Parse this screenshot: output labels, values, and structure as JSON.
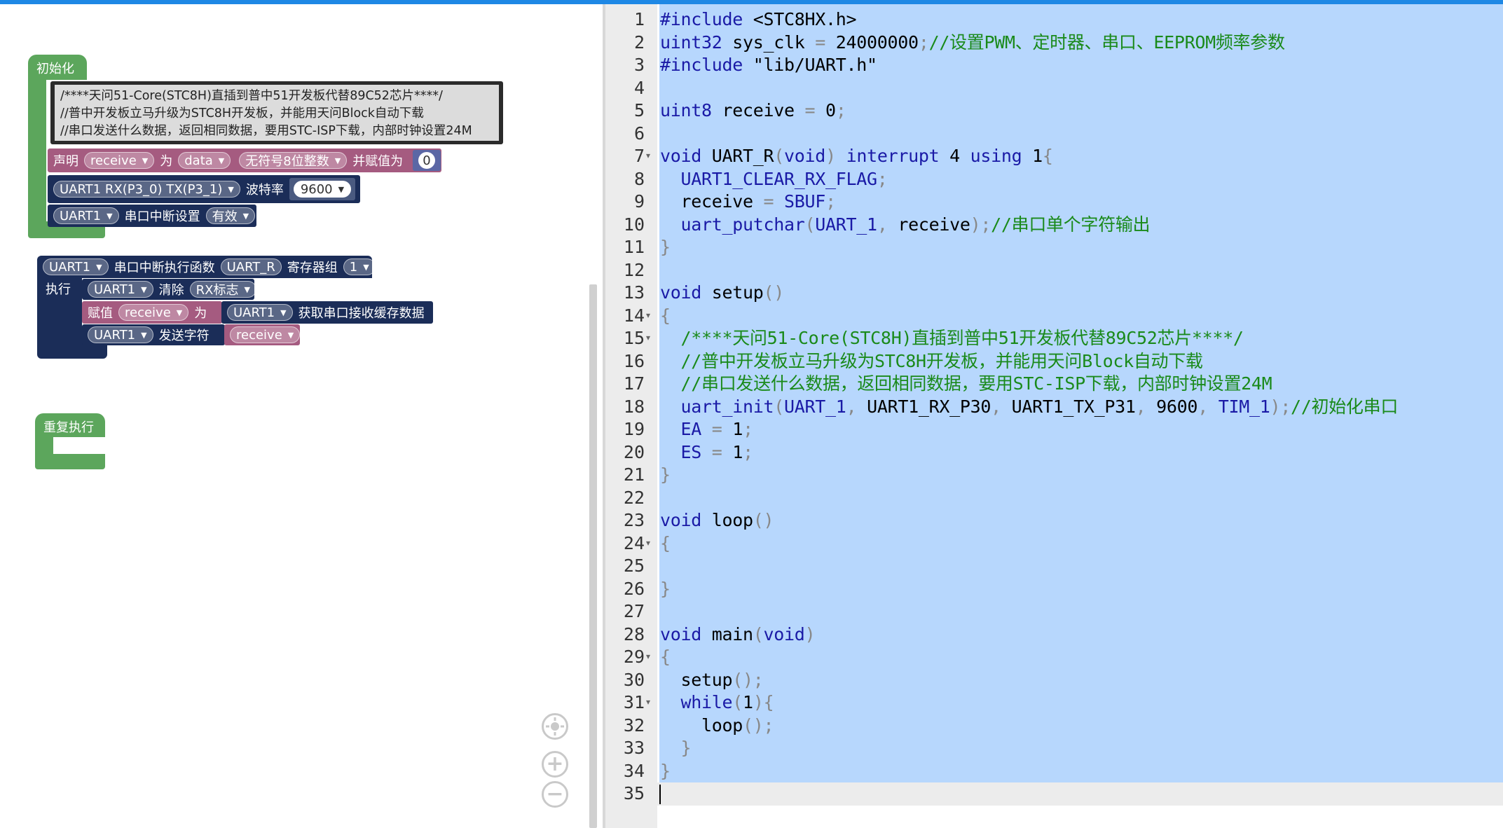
{
  "blocks": {
    "setup_label": "初始化",
    "comment_lines": [
      "/****天问51-Core(STC8H)直插到普中51开发板代替89C52芯片****/",
      "//普中开发板立马升级为STC8H开发板，并能用天问Block自动下载",
      "//串口发送什么数据，返回相同数据，要用STC-ISP下载，内部时钟设置24M"
    ],
    "declare": {
      "label": "声明",
      "var": "receive",
      "as": "为",
      "type": "data",
      "dtype": "无符号8位整数",
      "init_label": "并赋值为",
      "init_value": "0"
    },
    "uart_init": {
      "pins": "UART1 RX(P3_0) TX(P3_1)",
      "baud_label": "波特率",
      "baud": "9600"
    },
    "uart_irq_set": {
      "port": "UART1",
      "label": "串口中断设置",
      "state": "有效"
    },
    "isr": {
      "port": "UART1",
      "label": "串口中断执行函数",
      "name": "UART_R",
      "reg_label": "寄存器组",
      "reg": "1",
      "exec_label": "执行",
      "clear": {
        "port": "UART1",
        "label": "清除",
        "flag": "RX标志"
      },
      "assign": {
        "label": "赋值",
        "var": "receive",
        "as": "为",
        "port": "UART1",
        "get_label": "获取串口接收缓存数据"
      },
      "send": {
        "port": "UART1",
        "label": "发送字符",
        "var": "receive"
      }
    },
    "loop_label": "重复执行"
  },
  "colors": {
    "green": "#5ca65c",
    "navy": "#1b2d58",
    "pink": "#a55b80",
    "number": "#5b67a5"
  },
  "icons": {
    "recenter": "target-icon",
    "zoom_in": "plus-icon",
    "zoom_out": "minus-icon"
  },
  "code_lines": [
    "#include <STC8HX.h>",
    "uint32 sys_clk = 24000000;//设置PWM、定时器、串口、EEPROM频率参数",
    "#include \"lib/UART.h\"",
    "",
    "uint8 receive = 0;",
    "",
    "void UART_R(void) interrupt 4 using 1{",
    "  UART1_CLEAR_RX_FLAG;",
    "  receive = SBUF;",
    "  uart_putchar(UART_1, receive);//串口单个字符输出",
    "}",
    "",
    "void setup()",
    "{",
    "  /****天问51-Core(STC8H)直插到普中51开发板代替89C52芯片****/",
    "  //普中开发板立马升级为STC8H开发板，并能用天问Block自动下载",
    "  //串口发送什么数据，返回相同数据，要用STC-ISP下载，内部时钟设置24M",
    "  uart_init(UART_1, UART1_RX_P30, UART1_TX_P31, 9600, TIM_1);//初始化串口",
    "  EA = 1;",
    "  ES = 1;",
    "}",
    "",
    "void loop()",
    "{",
    "",
    "}",
    "",
    "void main(void)",
    "{",
    "  setup();",
    "  while(1){",
    "    loop();",
    "  }",
    "}",
    ""
  ],
  "fold_lines": [
    7,
    14,
    15,
    24,
    29,
    31
  ]
}
